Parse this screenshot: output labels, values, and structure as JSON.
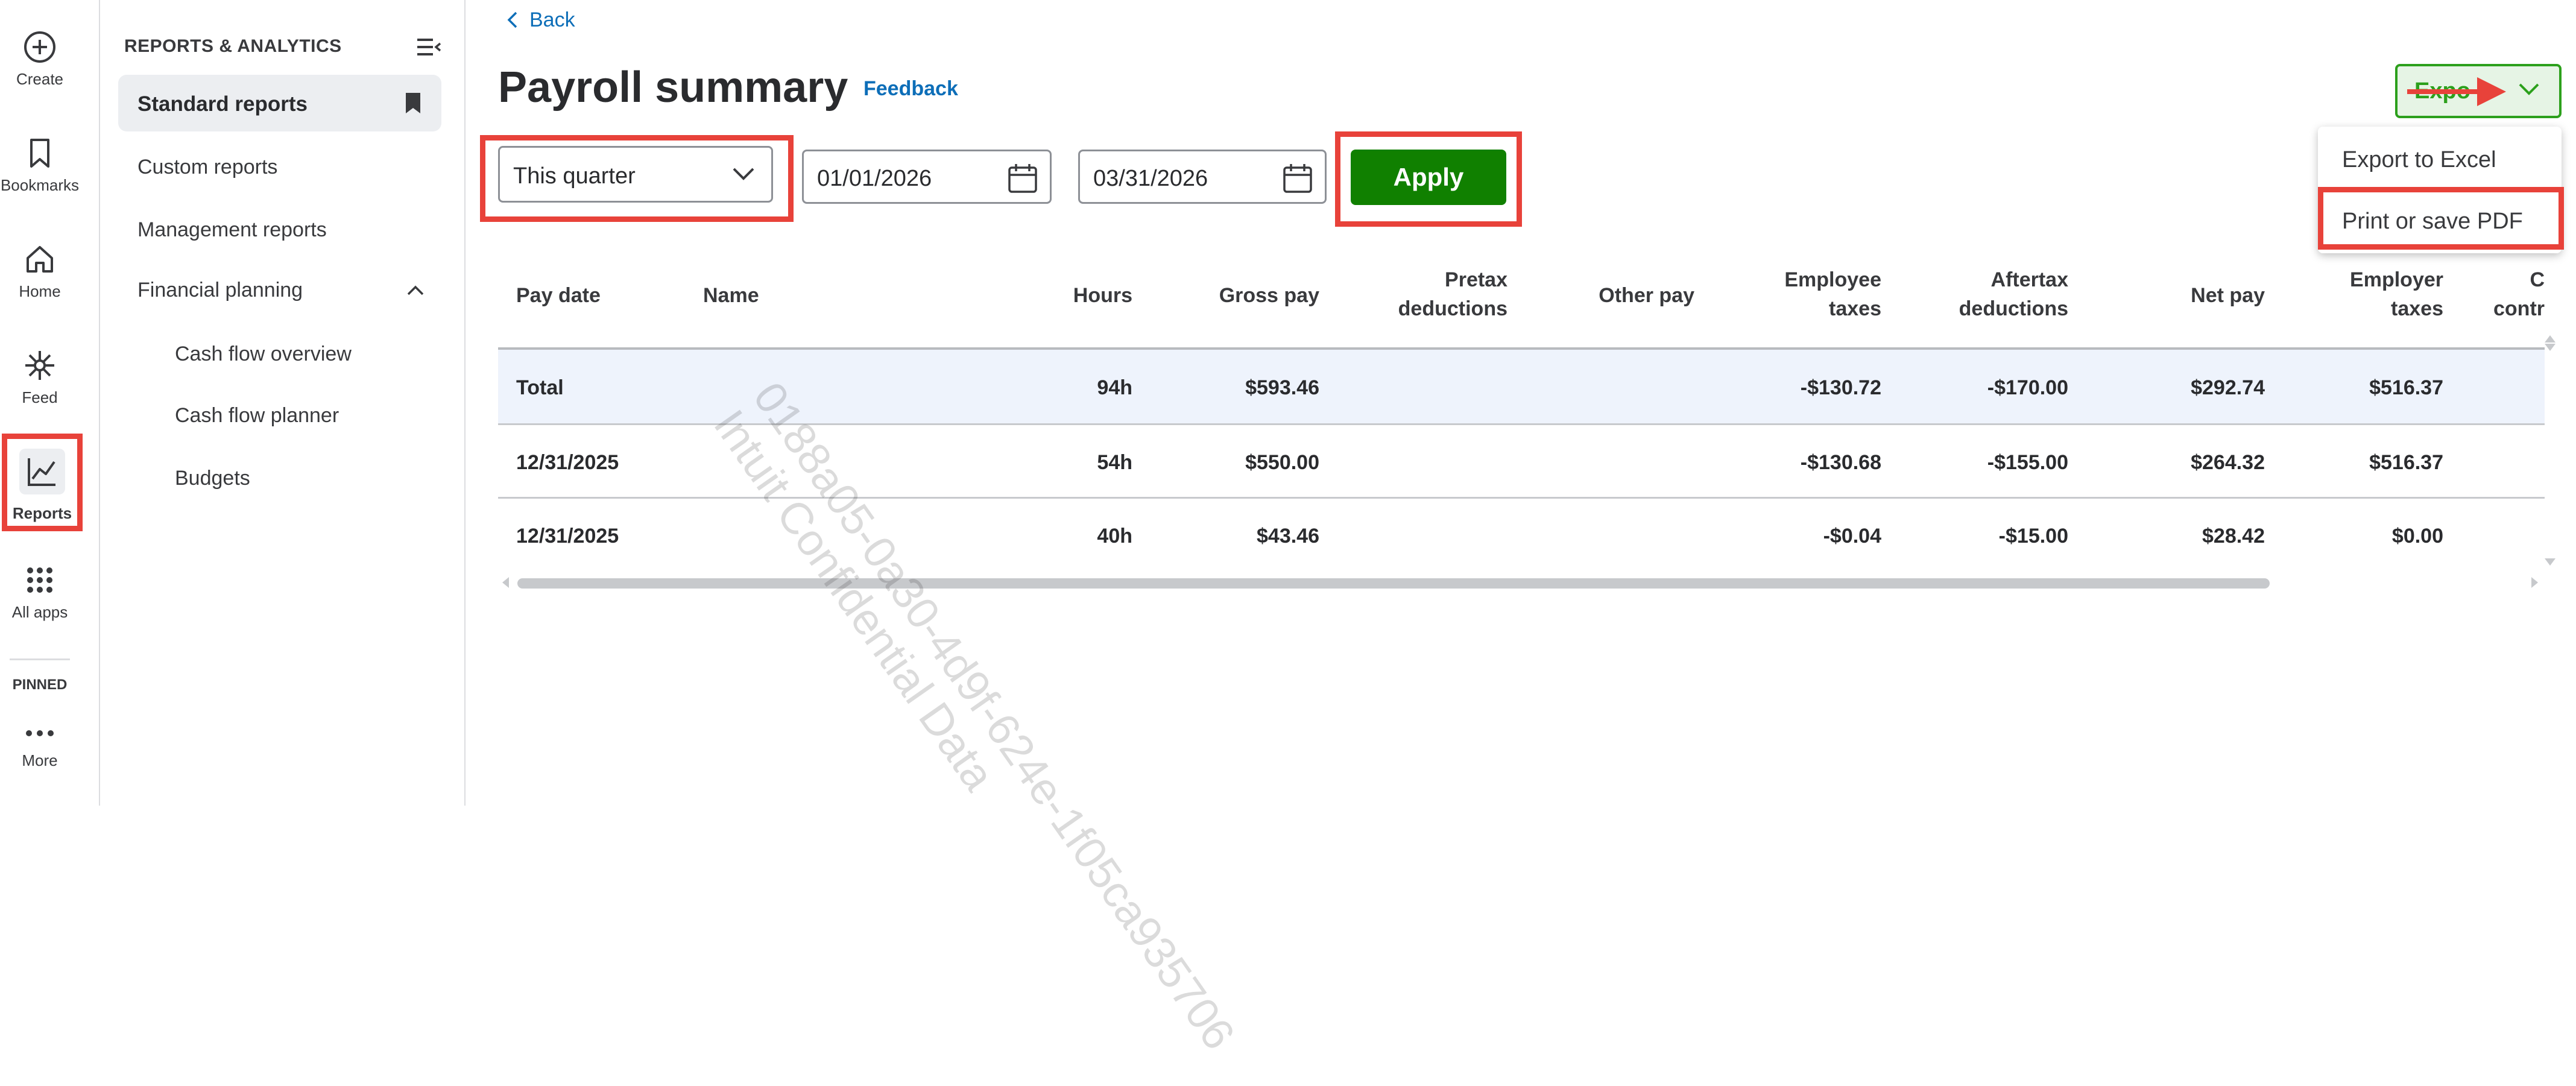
{
  "rail": {
    "items": [
      {
        "label": "Create",
        "icon": "plus-circle-icon"
      },
      {
        "label": "Bookmarks",
        "icon": "bookmark-icon"
      },
      {
        "label": "Home",
        "icon": "home-icon"
      },
      {
        "label": "Feed",
        "icon": "sparkle-icon"
      },
      {
        "label": "Reports",
        "icon": "chart-line-icon"
      },
      {
        "label": "All apps",
        "icon": "grid-dots-icon"
      }
    ],
    "pinned_label": "PINNED",
    "more_label": "More"
  },
  "subnav": {
    "title": "REPORTS & ANALYTICS",
    "items": [
      {
        "label": "Standard reports"
      },
      {
        "label": "Custom reports"
      },
      {
        "label": "Management reports"
      },
      {
        "label": "Financial planning"
      },
      {
        "label": "Cash flow overview"
      },
      {
        "label": "Cash flow planner"
      },
      {
        "label": "Budgets"
      }
    ]
  },
  "header": {
    "back_label": "Back",
    "title": "Payroll summary",
    "feedback_label": "Feedback"
  },
  "filters": {
    "range": "This quarter",
    "start_date": "01/01/2026",
    "end_date": "03/31/2026",
    "apply_label": "Apply"
  },
  "export": {
    "label": "Expo",
    "menu": [
      "Export to Excel",
      "Print or save PDF"
    ]
  },
  "table": {
    "headers": [
      "Pay date",
      "Name",
      "Hours",
      "Gross pay",
      "Pretax\ndeductions",
      "Other pay",
      "Employee\ntaxes",
      "Aftertax\ndeductions",
      "Net pay",
      "Employer\ntaxes",
      "C\ncontr"
    ],
    "rows": [
      {
        "pay_date": "Total",
        "name": "",
        "hours": "94h",
        "gross": "$593.46",
        "pretax": "",
        "other": "",
        "emp_taxes": "-$130.72",
        "aftertax": "-$170.00",
        "net": "$292.74",
        "employer_taxes": "$516.37"
      },
      {
        "pay_date": "12/31/2025",
        "name": "",
        "hours": "54h",
        "gross": "$550.00",
        "pretax": "",
        "other": "",
        "emp_taxes": "-$130.68",
        "aftertax": "-$155.00",
        "net": "$264.32",
        "employer_taxes": "$516.37"
      },
      {
        "pay_date": "12/31/2025",
        "name": "",
        "hours": "40h",
        "gross": "$43.46",
        "pretax": "",
        "other": "",
        "emp_taxes": "-$0.04",
        "aftertax": "-$15.00",
        "net": "$28.42",
        "employer_taxes": "$0.00"
      }
    ]
  },
  "watermark": {
    "line1": "0188a05-0a30-4d9f-624e-1f05ca935706",
    "line2": "Intuit Confidential Data"
  },
  "colors": {
    "brand_green": "#108000",
    "link_blue": "#0d6eb8",
    "highlight_red": "#e8423a"
  }
}
